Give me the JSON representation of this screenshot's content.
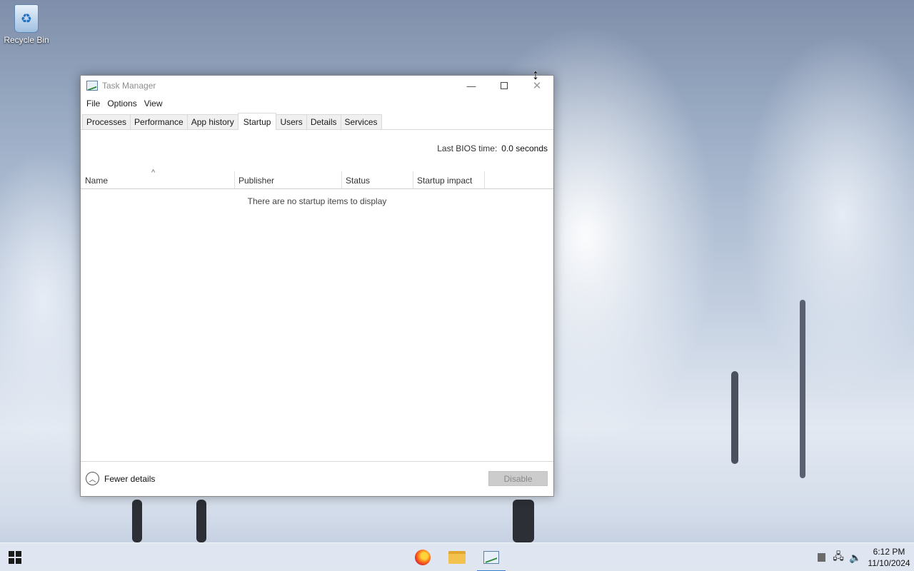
{
  "desktop": {
    "recycle_bin_label": "Recycle Bin",
    "icons": {
      "recycle_bin": "recycle-bin-icon"
    }
  },
  "window": {
    "title": "Task Manager",
    "menu": [
      "File",
      "Options",
      "View"
    ],
    "tabs": [
      "Processes",
      "Performance",
      "App history",
      "Startup",
      "Users",
      "Details",
      "Services"
    ],
    "active_tab": "Startup",
    "bios": {
      "label": "Last BIOS time:",
      "value": "0.0 seconds"
    },
    "columns": [
      "Name",
      "Publisher",
      "Status",
      "Startup impact"
    ],
    "empty_message": "There are no startup items to display",
    "footer": {
      "fewer_details": "Fewer details",
      "disable_button": "Disable"
    }
  },
  "taskbar": {
    "apps": [
      "Firefox",
      "File Explorer",
      "Task Manager"
    ],
    "clock": {
      "time": "6:12 PM",
      "date": "11/10/2024"
    }
  }
}
